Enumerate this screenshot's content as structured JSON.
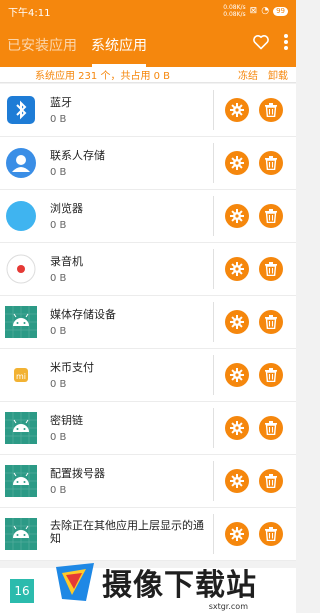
{
  "status": {
    "time": "下午4:11",
    "speed_up": "0.08K/s",
    "speed_down": "0.08K/s",
    "battery": "99"
  },
  "tabs": [
    {
      "label": "已安装应用"
    },
    {
      "label": "系统应用"
    }
  ],
  "summary": {
    "text": "系统应用 231 个，共占用 0 B",
    "col_freeze": "冻结",
    "col_uninstall": "卸载"
  },
  "apps": [
    {
      "name": "蓝牙",
      "size": "0 B",
      "icon": "bluetooth-icon"
    },
    {
      "name": "联系人存储",
      "size": "0 B",
      "icon": "contacts-icon"
    },
    {
      "name": "浏览器",
      "size": "0 B",
      "icon": "browser-icon"
    },
    {
      "name": "录音机",
      "size": "0 B",
      "icon": "recorder-icon"
    },
    {
      "name": "媒体存储设备",
      "size": "0 B",
      "icon": "android-icon"
    },
    {
      "name": "米币支付",
      "size": "0 B",
      "icon": "mi-pay-icon"
    },
    {
      "name": "密钥链",
      "size": "0 B",
      "icon": "android-icon"
    },
    {
      "name": "配置拨号器",
      "size": "0 B",
      "icon": "android-icon"
    },
    {
      "name": "去除正在其他应用上层显示的通知",
      "size": "",
      "icon": "android-icon"
    }
  ],
  "last_row_icon_text": "16",
  "watermark": {
    "text": "摄像下载站",
    "url": "sxtgr.com"
  },
  "colors": {
    "accent": "#f5870d",
    "android_green": "#2c9a86"
  }
}
